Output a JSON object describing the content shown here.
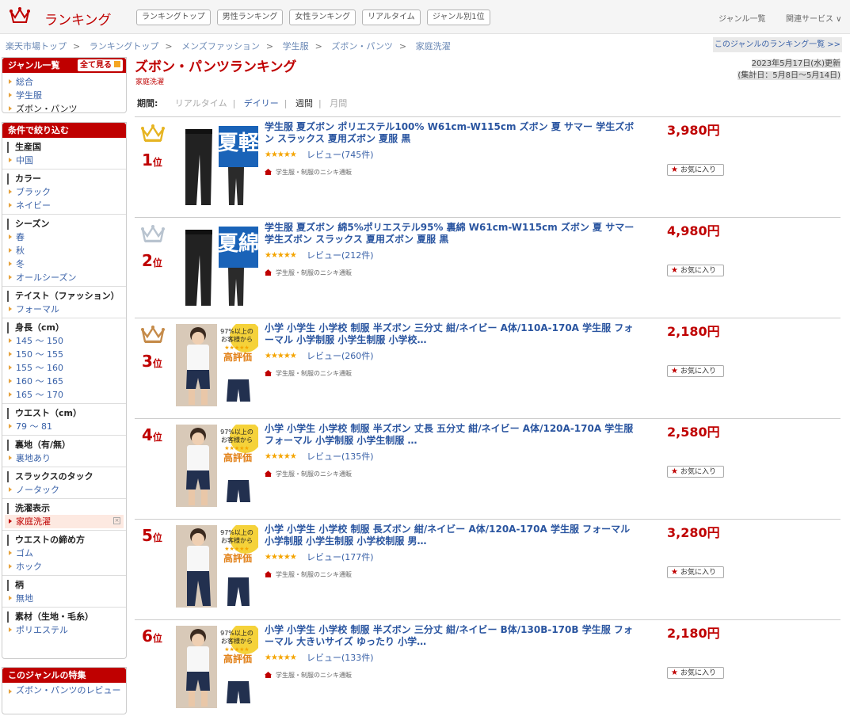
{
  "header": {
    "logo_text": "ランキング",
    "nav": [
      "ランキングトップ",
      "男性ランキング",
      "女性ランキング",
      "リアルタイム",
      "ジャンル別1位"
    ],
    "genre_list": "ジャンル一覧",
    "related": "関連サービス ∨"
  },
  "breadcrumb": [
    "楽天市場トップ",
    "ランキングトップ",
    "メンズファッション",
    "学生服",
    "ズボン・パンツ",
    "家庭洗濯"
  ],
  "genre_ranking_link": "このジャンルのランキング一覧 >>",
  "sidebar": {
    "genre_title": "ジャンル一覧",
    "see_all": "全て見る",
    "genres": [
      "総合",
      "学生服",
      "ズボン・パンツ"
    ],
    "filter_title": "条件で絞り込む",
    "filters": [
      {
        "title": "生産国",
        "items": [
          "中国"
        ]
      },
      {
        "title": "カラー",
        "items": [
          "ブラック",
          "ネイビー"
        ]
      },
      {
        "title": "シーズン",
        "items": [
          "春",
          "秋",
          "冬",
          "オールシーズン"
        ]
      },
      {
        "title": "テイスト（ファッション）",
        "items": [
          "フォーマル"
        ]
      },
      {
        "title": "身長（cm）",
        "items": [
          "145 ～ 150",
          "150 ～ 155",
          "155 ～ 160",
          "160 ～ 165",
          "165 ～ 170"
        ]
      },
      {
        "title": "ウエスト（cm）",
        "items": [
          "79 ～ 81"
        ]
      },
      {
        "title": "裏地（有/無）",
        "items": [
          "裏地あり"
        ]
      },
      {
        "title": "スラックスのタック",
        "items": [
          "ノータック"
        ]
      },
      {
        "title": "洗濯表示",
        "items": [
          "家庭洗濯"
        ]
      },
      {
        "title": "ウエストの締め方",
        "items": [
          "ゴム",
          "ホック"
        ]
      },
      {
        "title": "柄",
        "items": [
          "無地"
        ]
      },
      {
        "title": "素材（生地・毛糸）",
        "items": [
          "ポリエステル"
        ]
      }
    ],
    "feature_title": "このジャンルの特集",
    "feature_items": [
      "ズボン・パンツのレビュー"
    ]
  },
  "main": {
    "title": "ズボン・パンツランキング",
    "subtitle": "家庭洗濯",
    "updated": "2023年5月17日(水)更新",
    "period_range": "(集計日：5月8日～5月14日)",
    "period_label": "期間:",
    "period_options": [
      "リアルタイム",
      "デイリー",
      "週間",
      "月間"
    ]
  },
  "products": [
    {
      "rank": "1",
      "unit": "位",
      "name": "学生服 夏ズボン ポリエステル100% W61cm-W115cm ズボン 夏 サマー 学生ズボン スラックス 夏用ズボン 夏服 黒",
      "reviews": "レビュー(745件)",
      "shop": "学生服・制服のニシキ通販",
      "price": "3,980円",
      "fav": "お気に入り",
      "img": "summer-pants-light",
      "crown": "#e6b422"
    },
    {
      "rank": "2",
      "unit": "位",
      "name": "学生服 夏ズボン 綿5%ポリエステル95% 裏綿 W61cm-W115cm ズボン 夏 サマー 学生ズボン スラックス 夏用ズボン 夏服 黒",
      "reviews": "レビュー(212件)",
      "shop": "学生服・制服のニシキ通販",
      "price": "4,980円",
      "fav": "お気に入り",
      "img": "summer-pants-cotton",
      "crown": "#b8c3cf"
    },
    {
      "rank": "3",
      "unit": "位",
      "name": "小学 小学生 小学校 制服 半ズボン 三分丈 紺/ネイビー A体/110A-170A 学生服 フォーマル 小学制服 小学生制服 小学校…",
      "reviews": "レビュー(260件)",
      "shop": "学生服・制服のニシキ通販",
      "price": "2,180円",
      "fav": "お気に入り",
      "img": "kid-shorts",
      "crown": "#c58b4a"
    },
    {
      "rank": "4",
      "unit": "位",
      "name": "小学 小学生 小学校 制服 半ズボン 丈長 五分丈 紺/ネイビー A体/120A-170A 学生服 フォーマル 小学制服 小学生制服 …",
      "reviews": "レビュー(135件)",
      "shop": "学生服・制服のニシキ通販",
      "price": "2,580円",
      "fav": "お気に入り",
      "img": "kid-shorts",
      "crown": ""
    },
    {
      "rank": "5",
      "unit": "位",
      "name": "小学 小学生 小学校 制服 長ズボン 紺/ネイビー A体/120A-170A 学生服 フォーマル 小学制服 小学生制服 小学校制服 男…",
      "reviews": "レビュー(177件)",
      "shop": "学生服・制服のニシキ通販",
      "price": "3,280円",
      "fav": "お気に入り",
      "img": "kid-long",
      "crown": ""
    },
    {
      "rank": "6",
      "unit": "位",
      "name": "小学 小学生 小学校 制服 半ズボン 三分丈 紺/ネイビー B体/130B-170B 学生服 フォーマル 大きいサイズ ゆったり 小学…",
      "reviews": "レビュー(133件)",
      "shop": "学生服・制服のニシキ通販",
      "price": "2,180円",
      "fav": "お気に入り",
      "img": "kid-shorts",
      "crown": ""
    }
  ],
  "promo": {
    "summer_light": "夏軽",
    "summer_cotton": "夏綿",
    "rating_badge": "97%以上の お客様から",
    "rating_text": "高評価"
  },
  "colors": {
    "brand": "#bf0000",
    "link": "#2a55a0",
    "star": "#f4a400"
  }
}
